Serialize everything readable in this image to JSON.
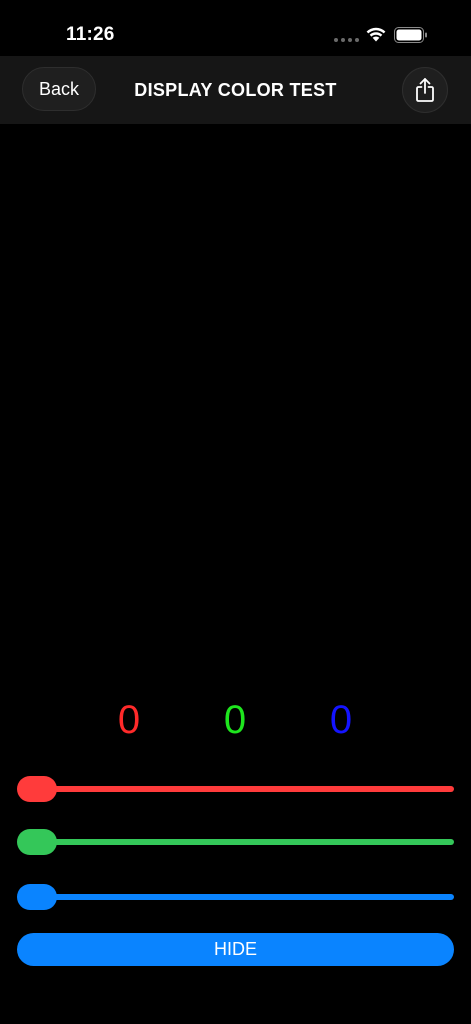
{
  "status_bar": {
    "time": "11:26"
  },
  "nav": {
    "back_label": "Back",
    "title": "DISPLAY COLOR TEST",
    "share_icon": "share-icon"
  },
  "color_values": {
    "red": "0",
    "green": "0",
    "blue": "0"
  },
  "sliders": {
    "red": {
      "value": 0,
      "color": "#ff3b3b"
    },
    "green": {
      "value": 0,
      "color": "#34c759"
    },
    "blue": {
      "value": 0,
      "color": "#0a84ff"
    }
  },
  "hide_button": {
    "label": "HIDE",
    "color": "#0a84ff"
  },
  "colors": {
    "background": "#000000",
    "nav_background": "#161616",
    "readout_red": "#ff2a2a",
    "readout_green": "#1ee61e",
    "readout_blue": "#1414ff"
  }
}
